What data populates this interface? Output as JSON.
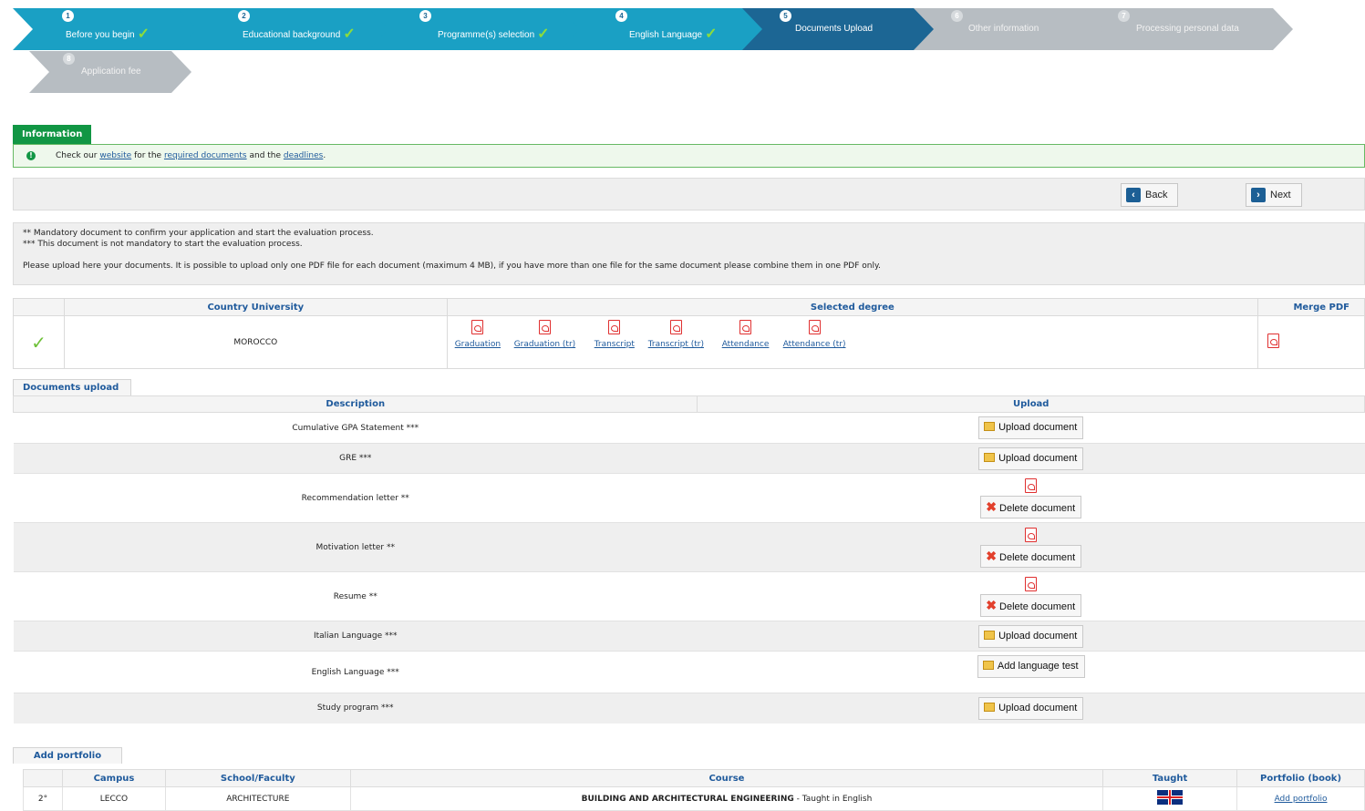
{
  "steps": [
    {
      "num": "1",
      "label": "Before you begin",
      "state": "done"
    },
    {
      "num": "2",
      "label": "Educational background",
      "state": "done"
    },
    {
      "num": "3",
      "label": "Programme(s) selection",
      "state": "done"
    },
    {
      "num": "4",
      "label": "English Language",
      "state": "done"
    },
    {
      "num": "5",
      "label": "Documents Upload",
      "state": "active"
    },
    {
      "num": "6",
      "label": "Other information",
      "state": "todo"
    },
    {
      "num": "7",
      "label": "Processing personal data",
      "state": "todo"
    },
    {
      "num": "8",
      "label": "Application fee",
      "state": "todo"
    }
  ],
  "info": {
    "tab": "Information",
    "text_1": "Check our ",
    "link_website": "website",
    "text_2": " for the ",
    "link_required": "required documents",
    "text_3": " and the ",
    "link_deadlines": "deadlines",
    "text_4": "."
  },
  "nav": {
    "back": "Back",
    "next": "Next"
  },
  "notes": {
    "line1": "** Mandatory document to confirm your application and start the evaluation process.",
    "line2": "*** This document is not mandatory to start the evaluation process.",
    "line3": "Please upload here your documents. It is possible to upload only one PDF file for each document (maximum 4 MB), if you have more than one file for the same document please combine them in one PDF only."
  },
  "degree_table": {
    "headers": {
      "country_university": "Country University",
      "selected_degree": "Selected degree",
      "merge_pdf": "Merge PDF"
    },
    "row": {
      "country": "MOROCCO",
      "docs": [
        "Graduation",
        "Graduation (tr)",
        "Transcript",
        "Transcript (tr)",
        "Attendance",
        "Attendance (tr)"
      ]
    }
  },
  "documents_upload": {
    "tab": "Documents upload",
    "headers": {
      "description": "Description",
      "upload": "Upload"
    },
    "rows": [
      {
        "description": "Cumulative GPA Statement  ***",
        "action": "Upload document"
      },
      {
        "description": "GRE  ***",
        "action": "Upload document"
      },
      {
        "description": "Recommendation letter  **",
        "action": "Delete document"
      },
      {
        "description": "Motivation letter  **",
        "action": "Delete document"
      },
      {
        "description": "Resume  **",
        "action": "Delete document"
      },
      {
        "description": "Italian Language  ***",
        "action": "Upload document"
      },
      {
        "description": "English Language  ***",
        "action": "Add language test"
      },
      {
        "description": "Study program  ***",
        "action": "Upload document"
      }
    ]
  },
  "portfolio": {
    "tab": "Add portfolio",
    "headers": {
      "campus": "Campus",
      "school": "School/Faculty",
      "course": "Course",
      "taught": "Taught",
      "portfolio": "Portfolio (book)"
    },
    "row": {
      "index": "2°",
      "campus": "LECCO",
      "school": "ARCHITECTURE",
      "course": "BUILDING AND ARCHITECTURAL ENGINEERING",
      "course_suffix": " - Taught in English",
      "portfolio_link": "Add portfolio"
    }
  },
  "colors": {
    "step_done": "#1aa0c4",
    "step_active": "#1c6694",
    "step_todo": "#b7bdc2",
    "info_green": "#119644",
    "link_blue": "#1f5a9c",
    "pdf_red": "#e03030"
  }
}
